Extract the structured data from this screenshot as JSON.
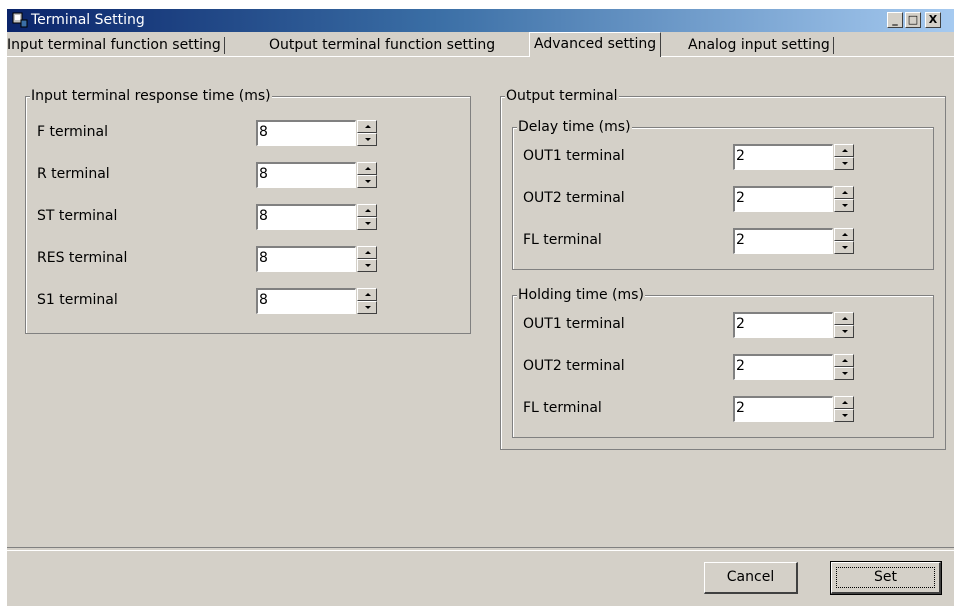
{
  "window": {
    "title": "Terminal Setting",
    "controls": {
      "minimize": "_",
      "maximize": "□",
      "close": "X"
    }
  },
  "tabs": [
    {
      "label": "Input terminal function setting"
    },
    {
      "label": "Output terminal function setting"
    },
    {
      "label": "Advanced setting"
    },
    {
      "label": "Analog input setting"
    }
  ],
  "input_group": {
    "title": "Input terminal response time (ms)",
    "rows": [
      {
        "label": "F terminal",
        "value": "8"
      },
      {
        "label": "R terminal",
        "value": "8"
      },
      {
        "label": "ST terminal",
        "value": "8"
      },
      {
        "label": "RES terminal",
        "value": "8"
      },
      {
        "label": "S1 terminal",
        "value": "8"
      }
    ]
  },
  "output_group": {
    "title": "Output terminal",
    "delay": {
      "title": "Delay time (ms)",
      "rows": [
        {
          "label": "OUT1 terminal",
          "value": "2"
        },
        {
          "label": "OUT2 terminal",
          "value": "2"
        },
        {
          "label": "FL terminal",
          "value": "2"
        }
      ]
    },
    "holding": {
      "title": "Holding time (ms)",
      "rows": [
        {
          "label": "OUT1 terminal",
          "value": "2"
        },
        {
          "label": "OUT2 terminal",
          "value": "2"
        },
        {
          "label": "FL terminal",
          "value": "2"
        }
      ]
    }
  },
  "buttons": {
    "cancel": "Cancel",
    "set": "Set"
  }
}
